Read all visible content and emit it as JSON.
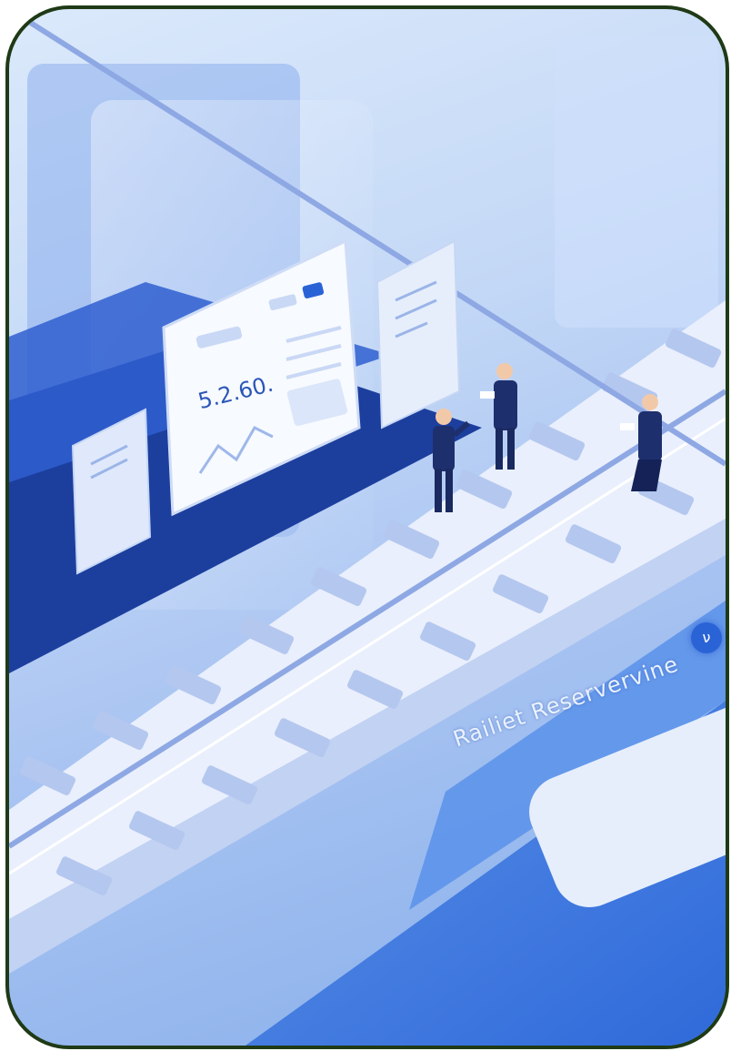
{
  "scene": {
    "banner_text": "Railiet Reservervine",
    "panel_value": "5.2.60.",
    "badge_glyph": "ν",
    "colors": {
      "frame_border": "#1f3a16",
      "accent_blue": "#2a63d6",
      "dark_navy": "#1c3f9e",
      "track_light": "#e9effc"
    },
    "people": [
      {
        "role": "person-standing-left"
      },
      {
        "role": "person-holding-tablet"
      },
      {
        "role": "person-walking-right"
      }
    ]
  }
}
